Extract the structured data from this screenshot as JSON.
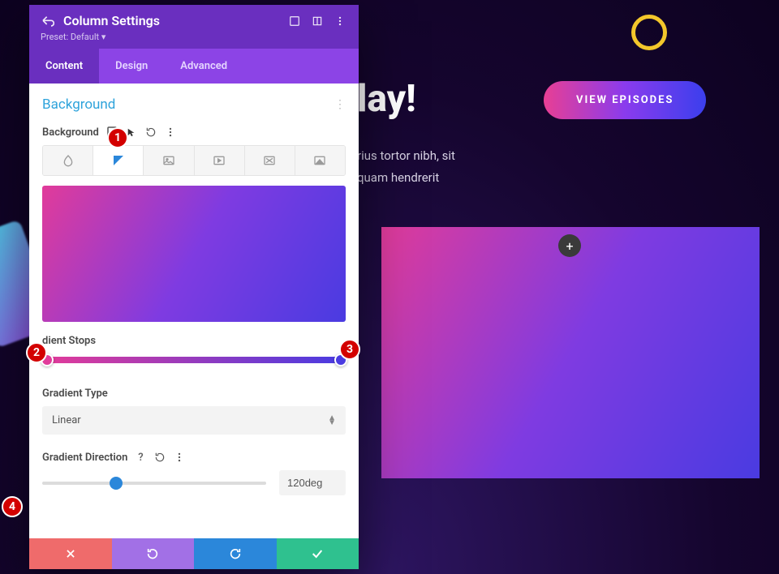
{
  "canvas": {
    "hero_title": "lay!",
    "hero_sub_line1": "rius tortor nibh, sit",
    "hero_sub_line2": "quam hendrerit",
    "cta_label": "VIEW EPISODES",
    "plus_label": "+"
  },
  "panel": {
    "title": "Column Settings",
    "preset_label": "Preset: Default",
    "tabs": {
      "content": "Content",
      "design": "Design",
      "advanced": "Advanced"
    },
    "section_title": "Background",
    "background_label": "Background",
    "gradient_stops_label": "dient Stops",
    "gradient_type_label": "Gradient Type",
    "gradient_type_value": "Linear",
    "gradient_direction_label": "Gradient Direction",
    "gradient_direction_value": "120deg",
    "gradient_colors": {
      "start": "#e13b9a",
      "end": "#4a3be1"
    },
    "icons": {
      "back": "back-arrow",
      "responsive": "responsive",
      "expand": "expand",
      "more": "more"
    }
  },
  "annotations": {
    "b1": "1",
    "b2": "2",
    "b3": "3",
    "b4": "4"
  }
}
